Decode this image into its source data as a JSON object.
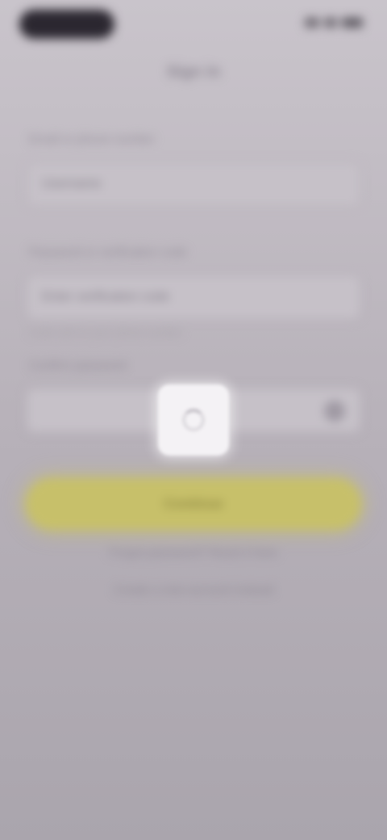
{
  "nav": {
    "title": "Sign in"
  },
  "form": {
    "field1": {
      "label": "Email or phone number",
      "value": "Username"
    },
    "field2": {
      "label": "Password or verification code",
      "value": "Enter verification code",
      "hint": "Code sent to your phone number"
    },
    "field3": {
      "label": "Confirm password"
    },
    "submit_label": "Continue"
  },
  "links": {
    "primary": "Forgot password? Reset it here",
    "secondary": "Create a new account instead"
  },
  "icons": [
    "status-signal-icon",
    "wifi-icon",
    "battery-icon",
    "eye-icon",
    "loading-spinner-icon"
  ],
  "colors": {
    "accent": "#c7c06a",
    "overlay": "#bdb8bf"
  }
}
